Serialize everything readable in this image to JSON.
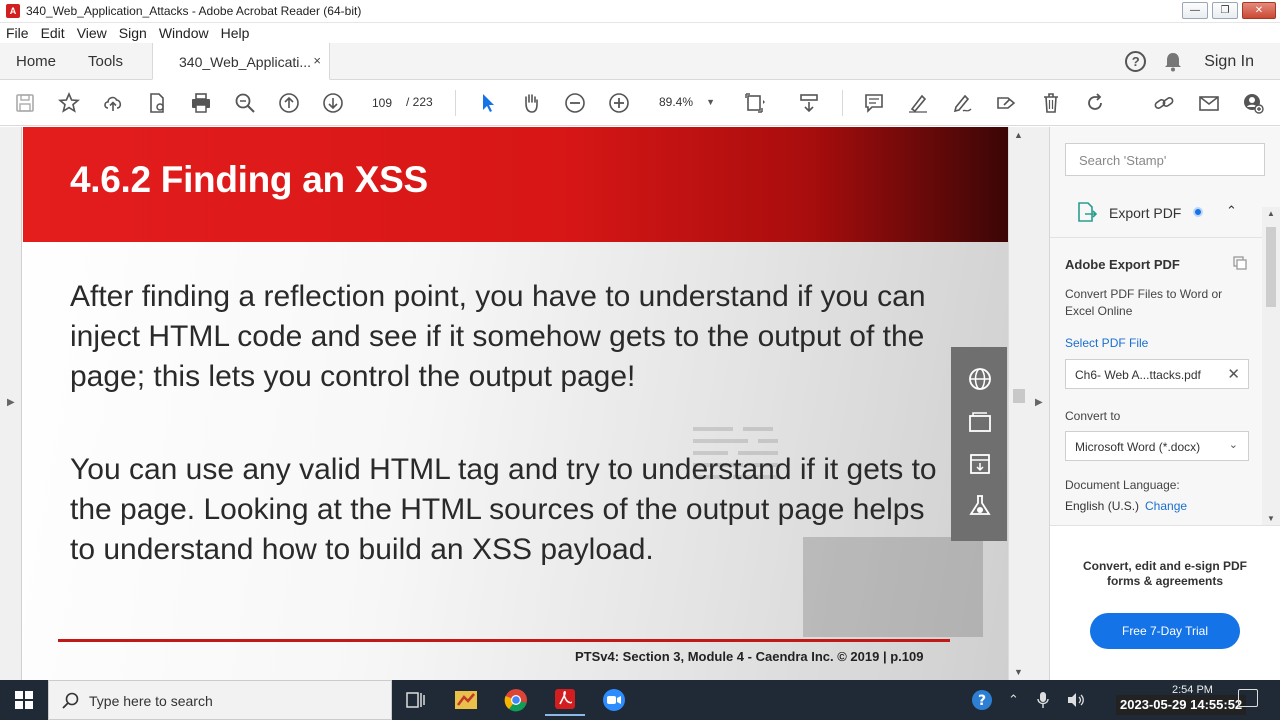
{
  "window": {
    "title": "340_Web_Application_Attacks - Adobe Acrobat Reader (64-bit)",
    "controls": {
      "minimize": "▭",
      "restore": "❐",
      "close": "✕"
    }
  },
  "menu": [
    "File",
    "Edit",
    "View",
    "Sign",
    "Window",
    "Help"
  ],
  "tabs": {
    "home": "Home",
    "tools": "Tools",
    "document": "340_Web_Applicati...",
    "close": "×",
    "signin": "Sign In",
    "help": "?"
  },
  "toolbar": {
    "page_current": "109",
    "page_total": "/ 223",
    "zoom": "89.4%"
  },
  "slide": {
    "title": "4.6.2 Finding an XSS",
    "paragraph1": "After finding a reflection point, you have to understand if you can inject HTML code and see if it somehow gets to the output of the page; this lets you control the output page!",
    "paragraph2": "You can use any valid HTML tag and try to understand if it gets to the page. Looking at the HTML sources of the output page helps to understand how to build an XSS payload.",
    "footer": "PTSv4: Section 3, Module 4 - Caendra Inc. © 2019 |   p.109"
  },
  "right_pane": {
    "search_placeholder": "Search 'Stamp'",
    "export_label": "Export PDF",
    "panel_title": "Adobe Export PDF",
    "description": "Convert PDF Files to Word or Excel Online",
    "select_link": "Select PDF File",
    "file_name": "Ch6- Web A...ttacks.pdf",
    "convert_to_label": "Convert to",
    "convert_to_value": "Microsoft Word (*.docx)",
    "doc_language_label": "Document Language:",
    "doc_language_value": "English (U.S.)",
    "change_link": "Change",
    "promo_text": "Convert, edit and e-sign PDF forms & agreements",
    "trial_button": "Free 7-Day Trial"
  },
  "taskbar": {
    "search_placeholder": "Type here to search",
    "clock_time": "2:54 PM",
    "overlay_timestamp": "2023-05-29 14:55:52"
  },
  "colors": {
    "slide_red": "#e41d1d",
    "accent_blue": "#1473e6",
    "taskbar": "#1f2a36"
  }
}
